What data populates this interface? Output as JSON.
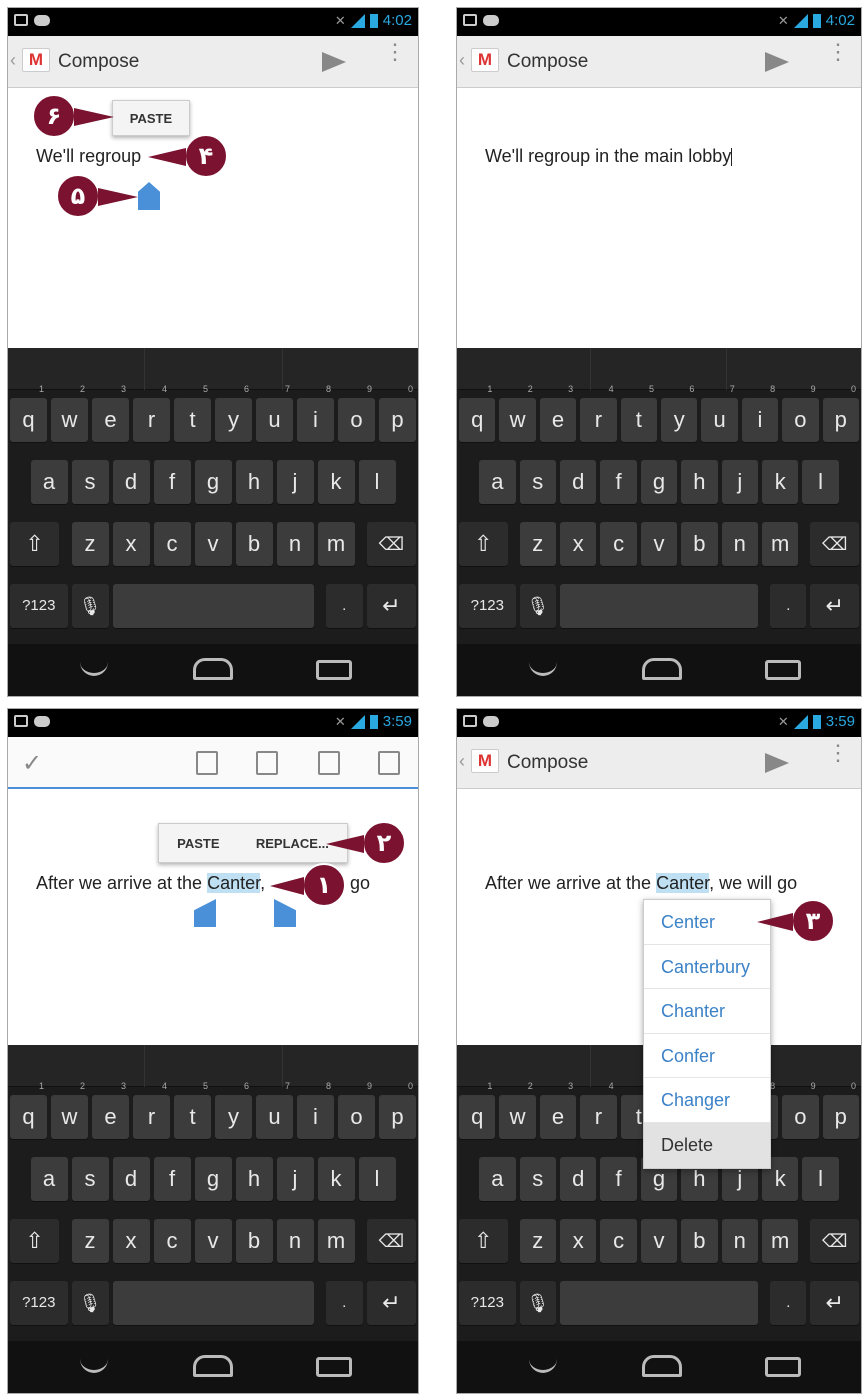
{
  "status": {
    "time_top": "4:02",
    "time_bottom": "3:59"
  },
  "app": {
    "title": "Compose"
  },
  "panel1": {
    "text": "We'll regroup",
    "popup_paste": "PASTE",
    "callouts": [
      "۶",
      "۴",
      "۵"
    ]
  },
  "panel2": {
    "text": "We'll regroup in the main lobby"
  },
  "panel3": {
    "text_before": "After we arrive at the ",
    "text_selected": "Canter",
    "text_after": ", ",
    "text_end": "go",
    "popup_paste": "PASTE",
    "popup_replace": "REPLACE...",
    "callouts": [
      "۲",
      "۱"
    ]
  },
  "panel4": {
    "text_before": "After we arrive at the ",
    "text_selected": "Canter",
    "text_after": ", we will go",
    "menu": [
      "Center",
      "Canterbury",
      "Chanter",
      "Confer",
      "Changer",
      "Delete"
    ],
    "callout": "۳"
  },
  "keyboard": {
    "row1": [
      "q",
      "w",
      "e",
      "r",
      "t",
      "y",
      "u",
      "i",
      "o",
      "p"
    ],
    "row1_nums": [
      "1",
      "2",
      "3",
      "4",
      "5",
      "6",
      "7",
      "8",
      "9",
      "0"
    ],
    "row2": [
      "a",
      "s",
      "d",
      "f",
      "g",
      "h",
      "j",
      "k",
      "l"
    ],
    "row3": [
      "z",
      "x",
      "c",
      "v",
      "b",
      "n",
      "m"
    ],
    "sym": "?123",
    "period": "."
  }
}
